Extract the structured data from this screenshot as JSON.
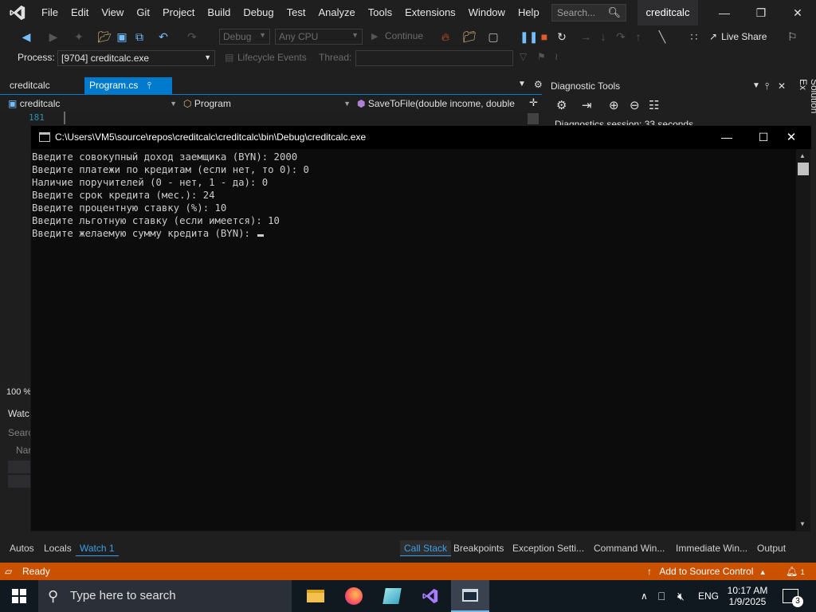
{
  "menu": {
    "items": [
      "File",
      "Edit",
      "View",
      "Git",
      "Project",
      "Build",
      "Debug",
      "Test",
      "Analyze",
      "Tools",
      "Extensions",
      "Window",
      "Help"
    ],
    "search_placeholder": "Search...",
    "solution_name": "creditcalc"
  },
  "toolbar": {
    "config": "Debug",
    "platform": "Any CPU",
    "continue_label": "Continue",
    "live_share": "Live Share"
  },
  "process_bar": {
    "process_label": "Process:",
    "process_value": "[9704] creditcalc.exe",
    "lifecycle_label": "Lifecycle Events",
    "thread_label": "Thread:"
  },
  "editor": {
    "tabs": [
      "creditcalc",
      "Program.cs"
    ],
    "nav_project": "creditcalc",
    "nav_class": "Program",
    "nav_member": "SaveToFile(double income, double",
    "line_number": "181",
    "zoom": "100 %"
  },
  "diagnostic": {
    "title": "Diagnostic Tools",
    "session_text": "Diagnostics session: 33 seconds",
    "solution_explorer_label": "Solution Ex"
  },
  "watch_panel": {
    "title": "Watc",
    "search": "Searc",
    "name_col": "Nar"
  },
  "bottom_tabs_left": [
    "Autos",
    "Locals",
    "Watch 1"
  ],
  "bottom_tabs_right": [
    "Call Stack",
    "Breakpoints",
    "Exception Setti...",
    "Command Win...",
    "Immediate Win...",
    "Output"
  ],
  "status": {
    "state": "Ready",
    "source_control": "Add to Source Control",
    "notifications": "1"
  },
  "console": {
    "title": "C:\\Users\\VM5\\source\\repos\\creditcalc\\creditcalc\\bin\\Debug\\creditcalc.exe",
    "lines": [
      "Введите совокупный доход заемщика (BYN): 2000",
      "Введите платежи по кредитам (если нет, то 0): 0",
      "Наличие поручителей (0 - нет, 1 - да): 0",
      "Введите срок кредита (мес.): 24",
      "Введите процентную ставку (%): 10",
      "Введите льготную ставку (если имеется): 10",
      "Введите желаемую сумму кредита (BYN): "
    ]
  },
  "taskbar": {
    "search_placeholder": "Type here to search",
    "language": "ENG",
    "time": "10:17 AM",
    "date": "1/9/2025",
    "notification_count": "3"
  },
  "colors": {
    "accent": "#007acc",
    "status_bar": "#ca5100",
    "console_bg": "#0c0c0c"
  }
}
